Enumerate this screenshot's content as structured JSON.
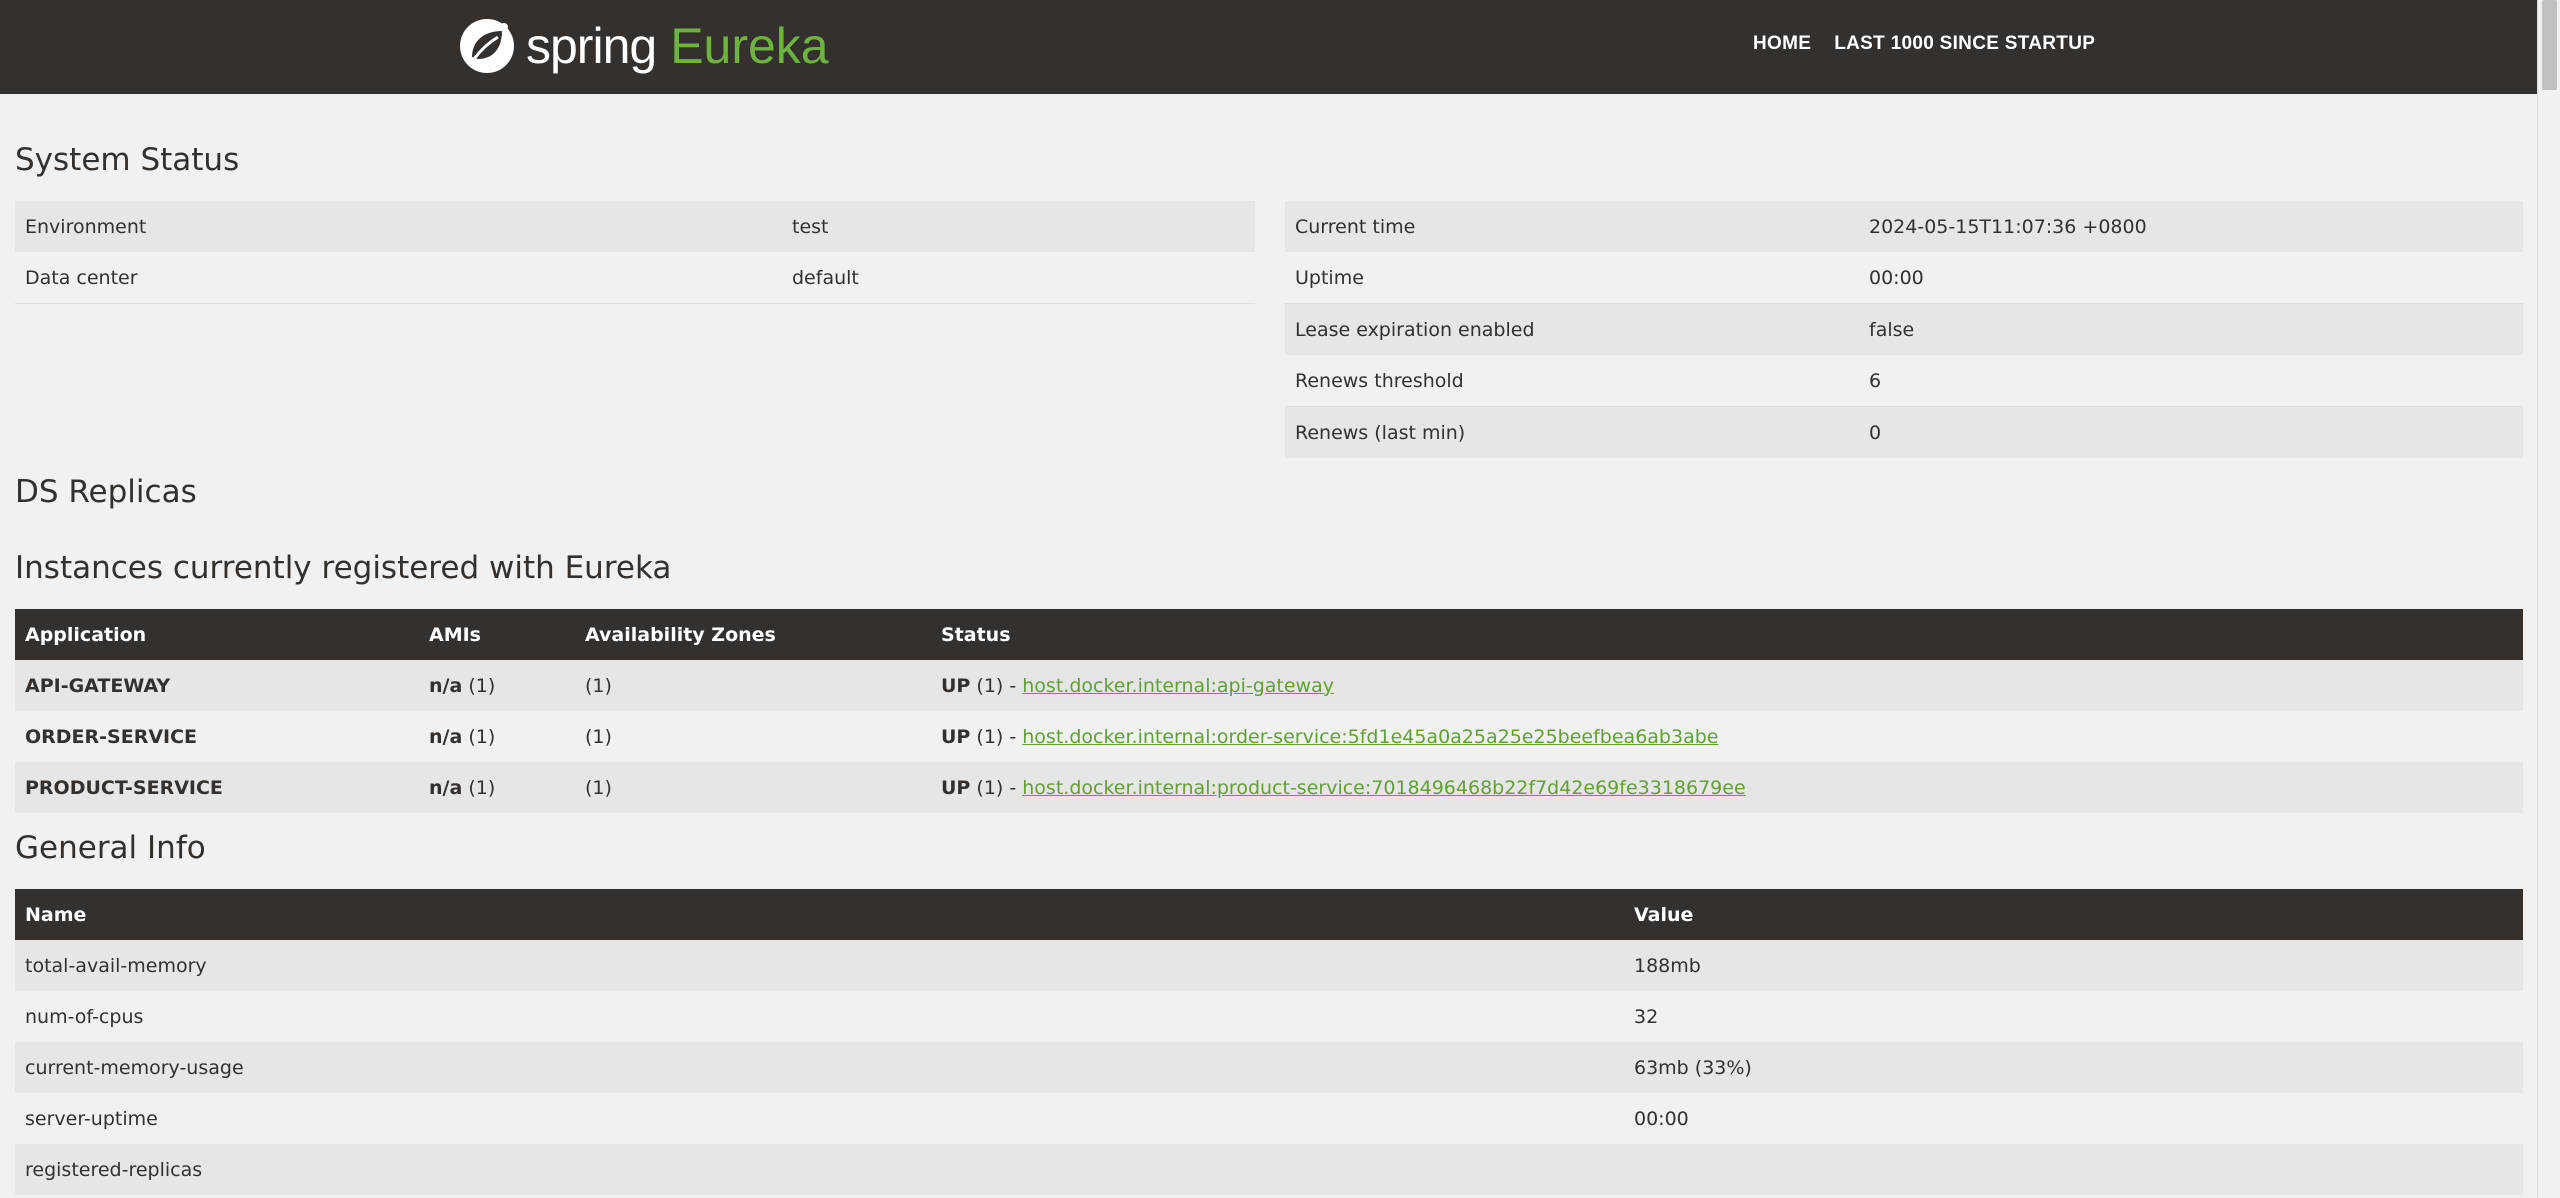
{
  "brand": {
    "spring": "spring",
    "eureka": "Eureka"
  },
  "nav": {
    "home": "HOME",
    "last1000": "LAST 1000 SINCE STARTUP"
  },
  "system_status": {
    "title": "System Status",
    "left": [
      {
        "label": "Environment",
        "value": "test"
      },
      {
        "label": "Data center",
        "value": "default"
      }
    ],
    "right": [
      {
        "label": "Current time",
        "value": "2024-05-15T11:07:36 +0800"
      },
      {
        "label": "Uptime",
        "value": "00:00"
      },
      {
        "label": "Lease expiration enabled",
        "value": "false"
      },
      {
        "label": "Renews threshold",
        "value": "6"
      },
      {
        "label": "Renews (last min)",
        "value": "0"
      }
    ]
  },
  "ds_replicas": {
    "title": "DS Replicas"
  },
  "instances": {
    "title": "Instances currently registered with Eureka",
    "headers": [
      "Application",
      "AMIs",
      "Availability Zones",
      "Status"
    ],
    "rows": [
      {
        "app": "API-GATEWAY",
        "ami": "n/a",
        "ami_count": "(1)",
        "zones": "(1)",
        "status": "UP",
        "status_count": "(1) -",
        "link": "host.docker.internal:api-gateway"
      },
      {
        "app": "ORDER-SERVICE",
        "ami": "n/a",
        "ami_count": "(1)",
        "zones": "(1)",
        "status": "UP",
        "status_count": "(1) -",
        "link": "host.docker.internal:order-service:5fd1e45a0a25a25e25beefbea6ab3abe"
      },
      {
        "app": "PRODUCT-SERVICE",
        "ami": "n/a",
        "ami_count": "(1)",
        "zones": "(1)",
        "status": "UP",
        "status_count": "(1) -",
        "link": "host.docker.internal:product-service:7018496468b22f7d42e69fe3318679ee"
      }
    ]
  },
  "general_info": {
    "title": "General Info",
    "headers": [
      "Name",
      "Value"
    ],
    "rows": [
      {
        "name": "total-avail-memory",
        "value": "188mb"
      },
      {
        "name": "num-of-cpus",
        "value": "32"
      },
      {
        "name": "current-memory-usage",
        "value": "63mb (33%)"
      },
      {
        "name": "server-uptime",
        "value": "00:00"
      },
      {
        "name": "registered-replicas",
        "value": ""
      }
    ]
  },
  "colors": {
    "navbar": "#34302d",
    "accent": "#6db33f",
    "link": "#5fa134",
    "background": "#f1f1f1",
    "stripe": "#e6e6e6"
  }
}
